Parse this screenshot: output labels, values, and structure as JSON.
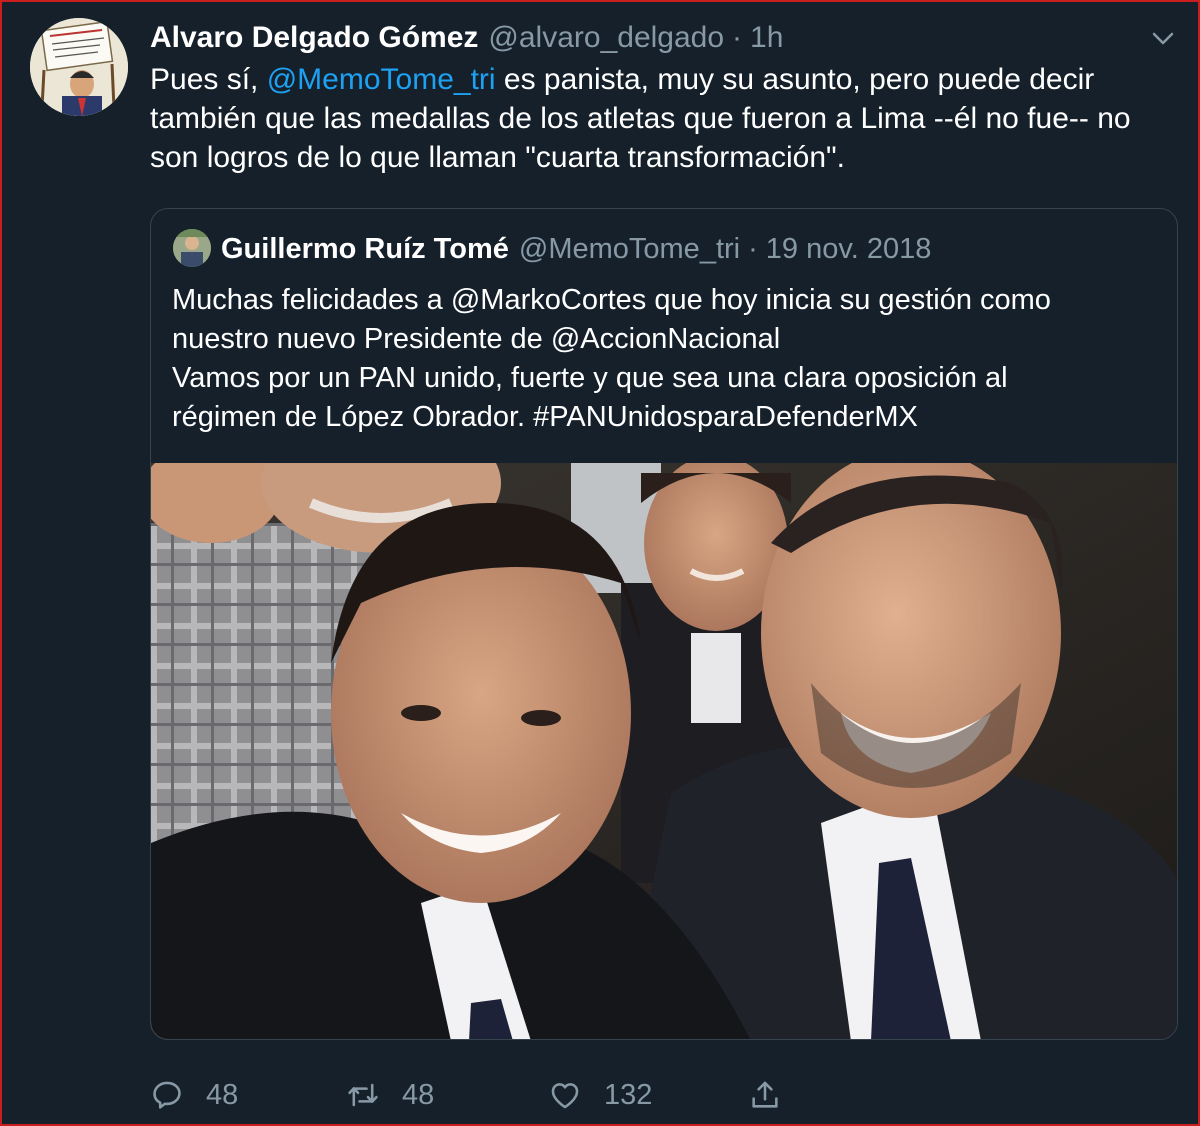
{
  "tweet": {
    "author_name": "Alvaro Delgado Gómez",
    "author_handle": "@alvaro_delgado",
    "separator": "·",
    "time": "1h",
    "text_before": "Pues sí, ",
    "mention": "@MemoTome_tri",
    "text_after": " es panista, muy su asunto, pero puede decir también que las medallas de los atletas que fueron a Lima --él no fue-- no son logros de lo que llaman \"cuarta transformación\"."
  },
  "quote": {
    "author_name": "Guillermo Ruíz Tomé",
    "author_handle": "@MemoTome_tri",
    "separator": "·",
    "date": "19 nov. 2018",
    "lines": [
      "Muchas felicidades a @MarkoCortes  que hoy inicia su gestión como",
      "nuestro nuevo Presidente de @AccionNacional",
      "Vamos por un PAN unido, fuerte y que sea una clara oposición al",
      "régimen de López Obrador. #PANUnidosparaDefenderMX"
    ]
  },
  "actions": {
    "reply_icon": "reply-icon",
    "reply_count": "48",
    "retweet_icon": "retweet-icon",
    "retweet_count": "48",
    "like_icon": "heart-icon",
    "like_count": "132",
    "share_icon": "share-icon"
  },
  "colors": {
    "background": "#15202b",
    "text": "#ffffff",
    "secondary": "#8899a6",
    "link": "#1da1f2",
    "border": "#38444d",
    "frame": "#c81e1e"
  }
}
